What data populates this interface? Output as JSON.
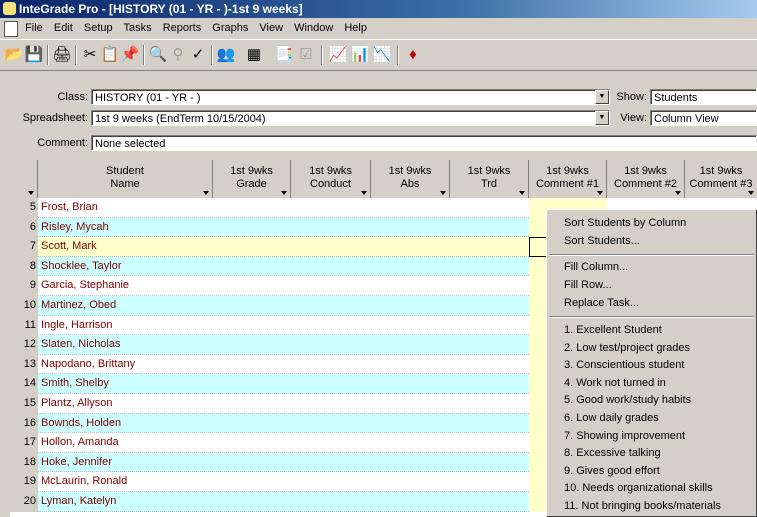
{
  "window": {
    "title": "InteGrade Pro - [HISTORY (01 - YR - )-1st 9 weeks]"
  },
  "menu": [
    "File",
    "Edit",
    "Setup",
    "Tasks",
    "Reports",
    "Graphs",
    "View",
    "Window",
    "Help"
  ],
  "toolbar_icons": [
    "open-icon",
    "save-icon",
    "print-icon",
    "cut-icon",
    "copy-icon",
    "paste-icon",
    "find-icon",
    "find-next-icon",
    "spellcheck-icon",
    "students-icon",
    "grid-icon",
    "clipboard-icon",
    "checklist-icon",
    "line-graph-icon",
    "bar-graph-icon",
    "area-graph-icon",
    "eraser-icon"
  ],
  "form": {
    "class_label": "Class:",
    "class_value": "HISTORY (01 - YR - )",
    "show_label": "Show:",
    "show_value": "Students",
    "spreadsheet_label": "Spreadsheet:",
    "spreadsheet_value": "1st 9 weeks (EndTerm 10/15/2004)",
    "view_label": "View:",
    "view_value": "Column View",
    "comment_label": "Comment:",
    "comment_value": "None selected"
  },
  "columns": [
    {
      "line1": "Student",
      "line2": "Name"
    },
    {
      "line1": "1st 9wks",
      "line2": "Grade"
    },
    {
      "line1": "1st 9wks",
      "line2": "Conduct"
    },
    {
      "line1": "1st 9wks",
      "line2": "Abs"
    },
    {
      "line1": "1st 9wks",
      "line2": "Trd"
    },
    {
      "line1": "1st 9wks",
      "line2": "Comment #1"
    },
    {
      "line1": "1st 9wks",
      "line2": "Comment #2"
    },
    {
      "line1": "1st 9wks",
      "line2": "Comment #3"
    }
  ],
  "rows": [
    {
      "num": "5",
      "name": "Frost, Brian"
    },
    {
      "num": "6",
      "name": "Risley, Mycah"
    },
    {
      "num": "7",
      "name": "Scott, Mark"
    },
    {
      "num": "8",
      "name": "Shocklee, Taylor"
    },
    {
      "num": "9",
      "name": "Garcia, Stephanie"
    },
    {
      "num": "10",
      "name": "Martinez, Obed"
    },
    {
      "num": "11",
      "name": "Ingle, Harrison"
    },
    {
      "num": "12",
      "name": "Slaten, Nicholas"
    },
    {
      "num": "13",
      "name": "Napodano, Brittany"
    },
    {
      "num": "14",
      "name": "Smith, Shelby"
    },
    {
      "num": "15",
      "name": "Plantz, Allyson"
    },
    {
      "num": "16",
      "name": "Bownds, Holden"
    },
    {
      "num": "17",
      "name": "Hollon, Amanda"
    },
    {
      "num": "18",
      "name": "Hoke, Jennifer"
    },
    {
      "num": "19",
      "name": "McLaurin, Ronald"
    },
    {
      "num": "20",
      "name": "Lyman, Katelyn"
    }
  ],
  "context_menu": {
    "group1": [
      "Sort Students by Column",
      "Sort Students..."
    ],
    "group2": [
      "Fill Column...",
      "Fill Row...",
      "Replace Task..."
    ],
    "comments": [
      "1. Excellent Student",
      "2. Low test/project grades",
      "3. Conscientious student",
      "4. Work not turned in",
      "5. Good work/study habits",
      "6. Low daily grades",
      "7. Showing improvement",
      "8. Excessive talking",
      "9. Gives good effort",
      "10. Needs organizational skills",
      "11. Not bringing books/materials"
    ]
  },
  "colors": {
    "row_white": "#ffffff",
    "row_cyan": "#ccffff",
    "row_highlight": "#ffffcc",
    "comment_col": "#ffffcc",
    "name_text": "#800000"
  }
}
